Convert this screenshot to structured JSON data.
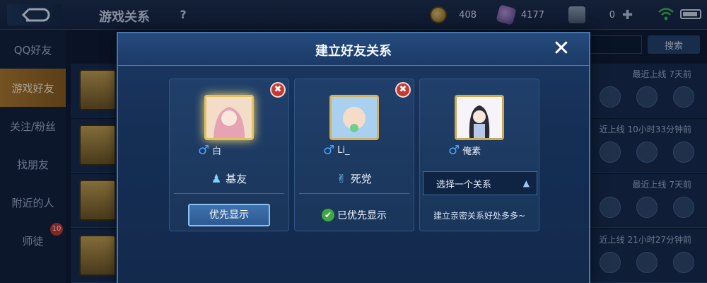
{
  "topbar": {
    "title": "游戏关系",
    "help": "?",
    "gold": "408",
    "diamond": "4177",
    "voucher": "0"
  },
  "sidebar": {
    "items": [
      {
        "label": "QQ好友"
      },
      {
        "label": "游戏好友"
      },
      {
        "label": "关注/粉丝"
      },
      {
        "label": "找朋友"
      },
      {
        "label": "附近的人"
      },
      {
        "label": "师徒",
        "badge": "10"
      }
    ]
  },
  "background": {
    "search_label": "搜索",
    "rows": [
      {
        "status": "最近上线  7天前"
      },
      {
        "status": "近上线  10小时33分钟前"
      },
      {
        "status": "最近上线  7天前"
      },
      {
        "status": "近上线  21小时27分钟前"
      }
    ]
  },
  "modal": {
    "title": "建立好友关系",
    "close": "✕",
    "cards": [
      {
        "name": "白",
        "relation": "基友",
        "action": "优先显示",
        "remove": "✖"
      },
      {
        "name": "Li_",
        "relation": "死党",
        "action": "已优先显示",
        "remove": "✖"
      },
      {
        "name": "俺素",
        "select": "选择一个关系",
        "hint": "建立亲密关系好处多多~"
      }
    ]
  }
}
